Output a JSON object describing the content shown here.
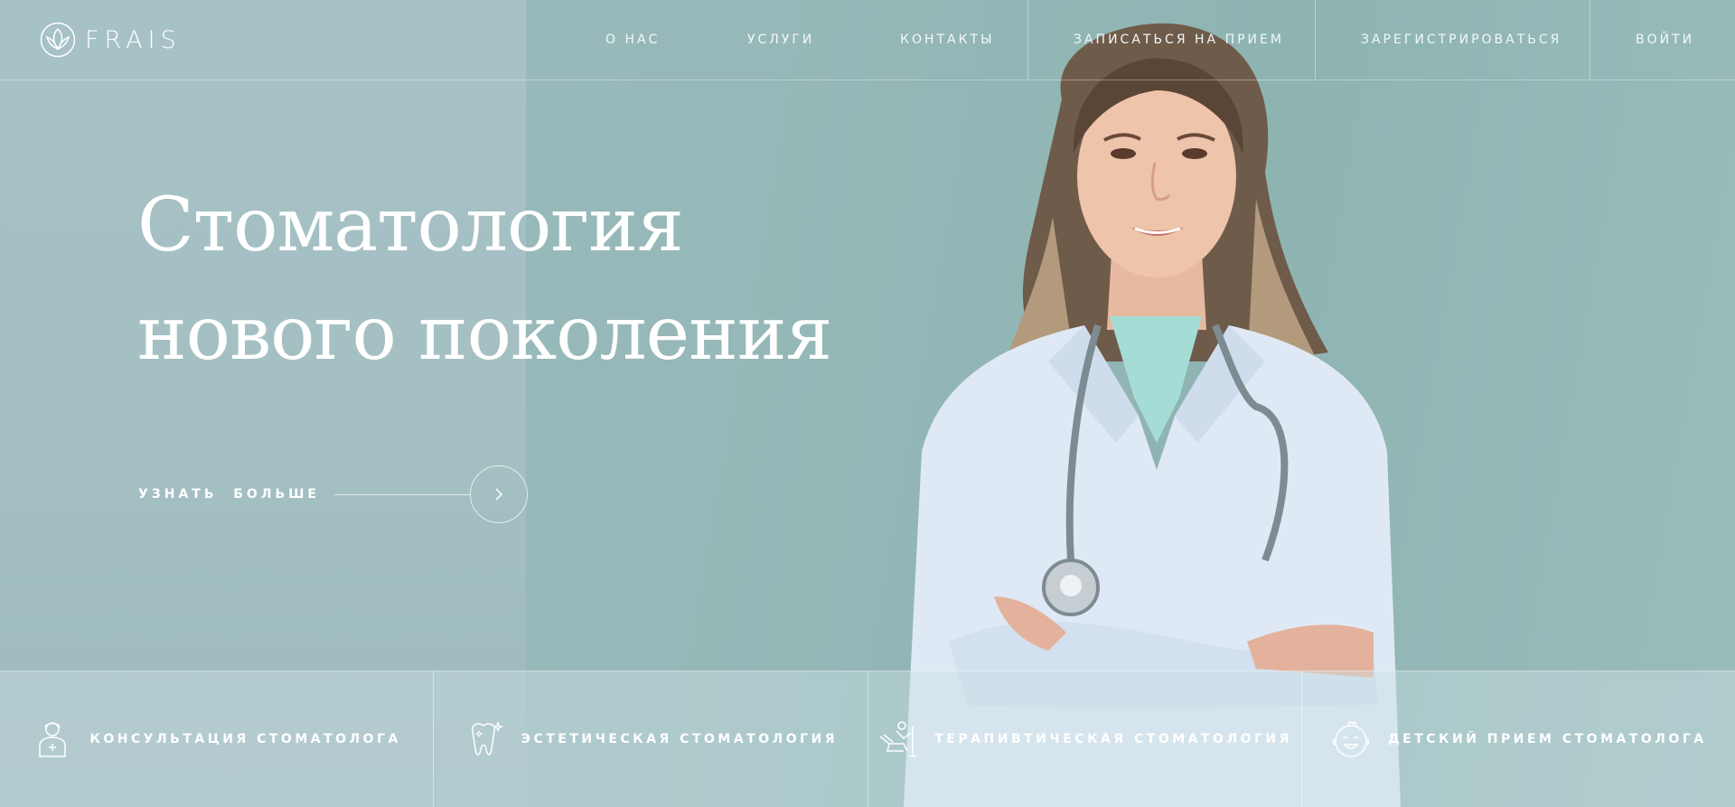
{
  "brand": {
    "name": "FRAIS",
    "logo_icon": "lotus-icon"
  },
  "nav": {
    "items": [
      {
        "label": "О НАС"
      },
      {
        "label": "УСЛУГИ"
      },
      {
        "label": "КОНТАКТЫ"
      },
      {
        "label": "ЗАПИСАТЬСЯ НА ПРИЕМ"
      },
      {
        "label": "ЗАРЕГИСТРИРОВАТЬСЯ"
      },
      {
        "label": "ВОЙТИ"
      }
    ]
  },
  "hero": {
    "title_line1": "Стоматология",
    "title_line2": "нового поколения",
    "cta_label": "УЗНАТЬ  БОЛЬШЕ",
    "cta_icon": "chevron-right-icon"
  },
  "services": [
    {
      "label": "КОНСУЛЬТАЦИЯ СТОМАТОЛОГА",
      "icon": "doctor-icon"
    },
    {
      "label": "ЭСТЕТИЧЕСКАЯ СТОМАТОЛОГИЯ",
      "icon": "sparkling-tooth-icon"
    },
    {
      "label": "ТЕРАПИВТИЧЕСКАЯ СТОМАТОЛОГИЯ",
      "icon": "dental-chair-icon"
    },
    {
      "label": "ДЕТСКИЙ ПРИЕМ СТОМАТОЛОГА",
      "icon": "baby-face-icon"
    }
  ],
  "colors": {
    "background": "#96b8b8",
    "left_panel": "#a7c2c6",
    "text": "#ffffff"
  }
}
